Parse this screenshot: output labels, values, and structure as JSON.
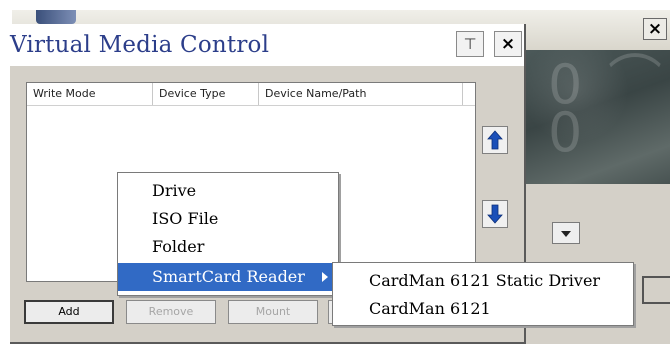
{
  "background_window": {
    "close_label": "×"
  },
  "dialog": {
    "title": "Virtual Media Control",
    "pin_label": "⊤",
    "close_label": "×",
    "columns": [
      "Write Mode",
      "Device Type",
      "Device Name/Path"
    ],
    "buttons": {
      "add": "Add",
      "remove": "Remove",
      "mount": "Mount"
    }
  },
  "context_menu": {
    "items": [
      "Drive",
      "ISO File",
      "Folder",
      "SmartCard Reader"
    ],
    "selected_index": 3
  },
  "submenu": {
    "items": [
      "CardMan 6121 Static Driver",
      "CardMan 6121"
    ]
  },
  "colors": {
    "title_text": "#2c3e8a",
    "menu_highlight": "#316ac5",
    "arrow_icon": "#1a4fb8"
  }
}
